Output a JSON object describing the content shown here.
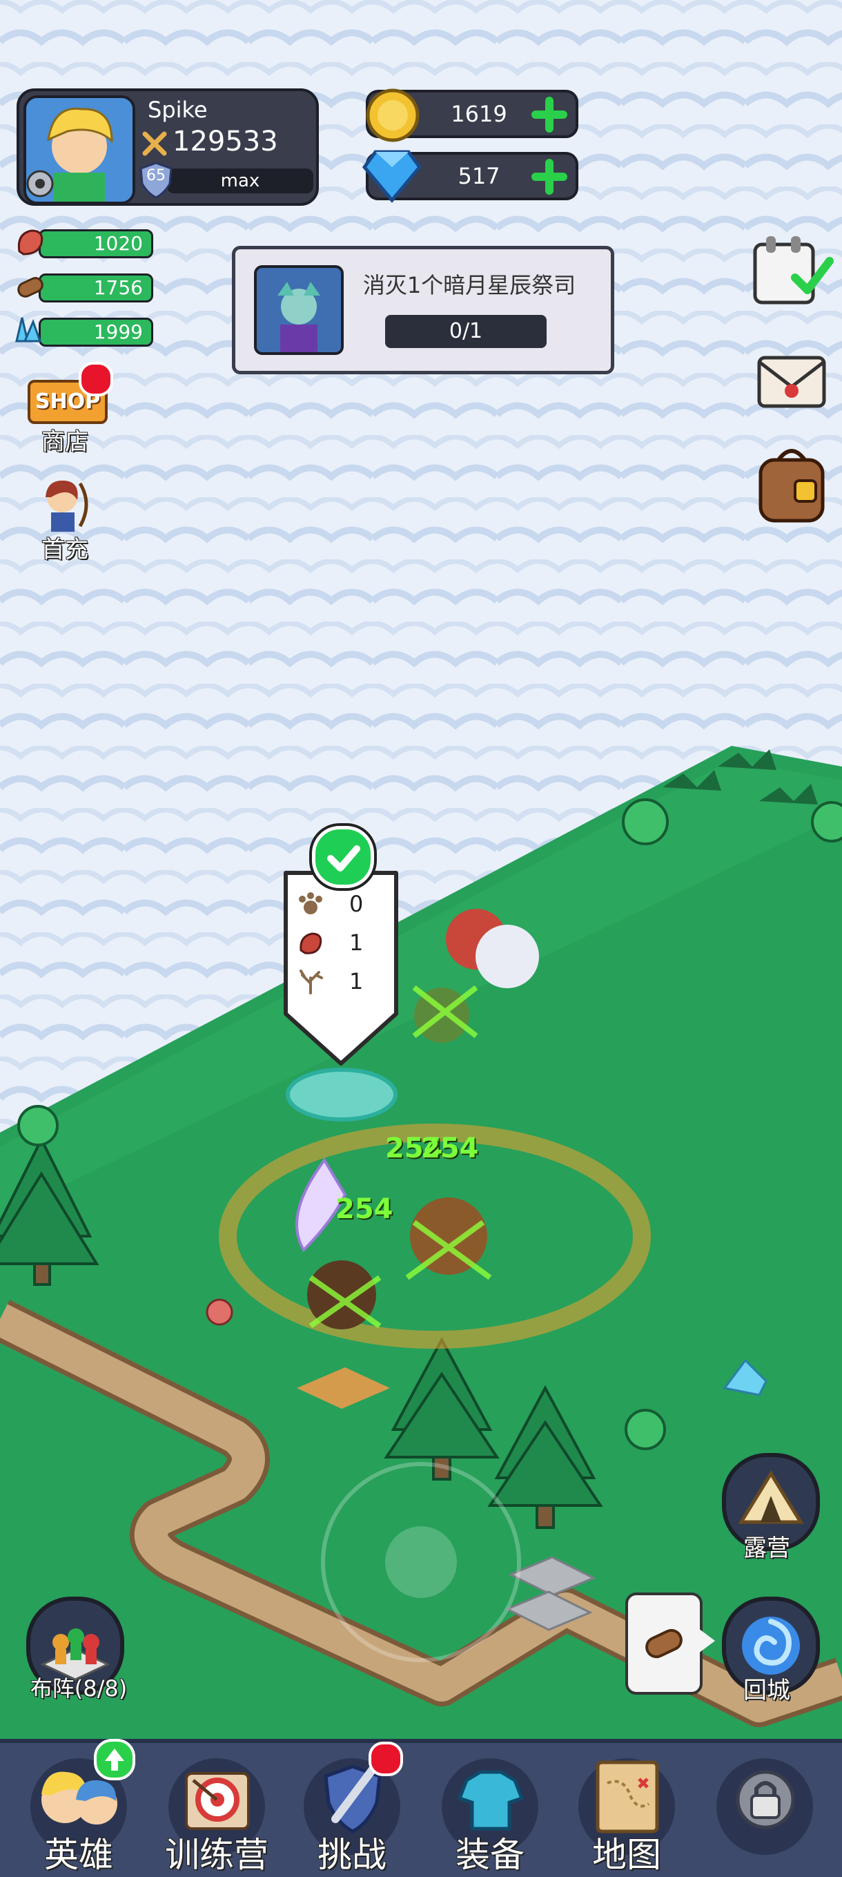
{
  "player": {
    "name": "Spike",
    "power": "129533",
    "level": "65",
    "exp_label": "max"
  },
  "currency": {
    "gold": "1619",
    "diamonds": "517"
  },
  "resources": {
    "meat": "1020",
    "wood": "1756",
    "crystal": "1999"
  },
  "shop": {
    "badge": "SHOP",
    "label": "商店"
  },
  "first_recharge": {
    "label": "首充"
  },
  "quest": {
    "title": "消灭1个暗月星辰祭司",
    "progress": "0/1"
  },
  "loot_popup": {
    "rows": [
      {
        "icon": "paw-icon",
        "count": "0"
      },
      {
        "icon": "meat-icon",
        "count": "1"
      },
      {
        "icon": "antler-icon",
        "count": "1"
      }
    ]
  },
  "damage_numbers": [
    "254",
    "254",
    "254"
  ],
  "right_buttons": {
    "camp": "露营",
    "return_city": "回城"
  },
  "formation": {
    "label": "布阵(8/8)"
  },
  "nav": [
    {
      "label": "英雄",
      "icon": "heroes-icon"
    },
    {
      "label": "训练营",
      "icon": "training-camp-icon"
    },
    {
      "label": "挑战",
      "icon": "challenge-icon"
    },
    {
      "label": "装备",
      "icon": "equipment-icon"
    },
    {
      "label": "地图",
      "icon": "map-icon"
    },
    {
      "label": "",
      "icon": "locked-icon"
    }
  ],
  "colors": {
    "grass": "#27a05a",
    "snow": "#e8f0fa",
    "path": "#c6a57a",
    "hp_bar": "#2cb85c",
    "nav_bg": "#3d4a6b"
  }
}
